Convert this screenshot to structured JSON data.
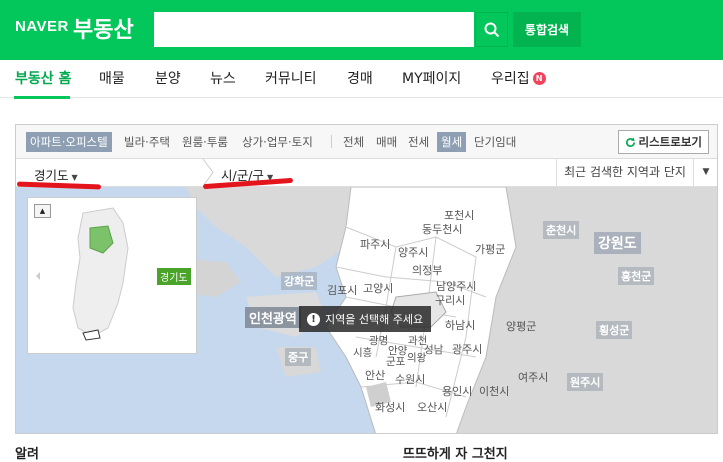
{
  "header": {
    "logo": "NAVER",
    "service": "부동산",
    "search_value": "",
    "search_icon": "search-icon",
    "total_search_label": "통합검색",
    "brand_color": "#03c75a"
  },
  "nav": {
    "items": [
      {
        "label": "부동산 홈"
      },
      {
        "label": "매물"
      },
      {
        "label": "분양"
      },
      {
        "label": "뉴스"
      },
      {
        "label": "커뮤니티"
      },
      {
        "label": "경매"
      },
      {
        "label": "MY페이지"
      },
      {
        "label": "우리집",
        "badge": "N"
      }
    ],
    "active_index": 0
  },
  "filters": {
    "property_types": [
      "아파트·오피스텔",
      "빌라·주택",
      "원룸·투룸",
      "상가·업무·토지"
    ],
    "selected_property_type": "아파트·오피스텔",
    "deal_types": [
      "전체",
      "매매",
      "전세",
      "월세",
      "단기임대"
    ],
    "selected_deal_type": "월세",
    "list_view_label": "리스트로보기",
    "refresh_icon": "refresh-icon"
  },
  "region": {
    "province": "경기도",
    "district": "시/군/구",
    "recent_label": "최근 검색한 지역과 단지"
  },
  "map": {
    "labels": {
      "pocheon": "포천시",
      "dongducheon": "동두천시",
      "paju": "파주시",
      "yangju": "양주시",
      "gapyeong": "가평군",
      "uijeongbu": "의정부",
      "chuncheon": "춘천시",
      "gangwon": "강원도",
      "hongcheon": "홍천군",
      "ganghwa": "강화군",
      "gimpo": "김포시",
      "goyang": "고양시",
      "namyangju": "남양주시",
      "guri": "구리시",
      "incheon": "인천광역",
      "hanam": "하남시",
      "yangpyeong": "양평군",
      "hoengseong": "횡성군",
      "jung": "중구",
      "siheung": "시흥",
      "gwangmyeong": "광명",
      "gunpo": "군포",
      "anyang": "안양",
      "seongnam": "성남",
      "gwacheon": "과천",
      "uiwang": "의왕",
      "gwangju": "광주시",
      "ansan": "안산",
      "suwon": "수원시",
      "yongin": "용인시",
      "icheon": "이천시",
      "yeoju": "여주시",
      "wonju": "원주시",
      "hwaseong": "화성시",
      "osan": "오산시"
    },
    "tooltip": "지역을 선택해 주세요",
    "minimap_tag": "경기도"
  },
  "below": {
    "left_title": "알려",
    "right_title": "뜨뜨하게 자 그천지"
  }
}
